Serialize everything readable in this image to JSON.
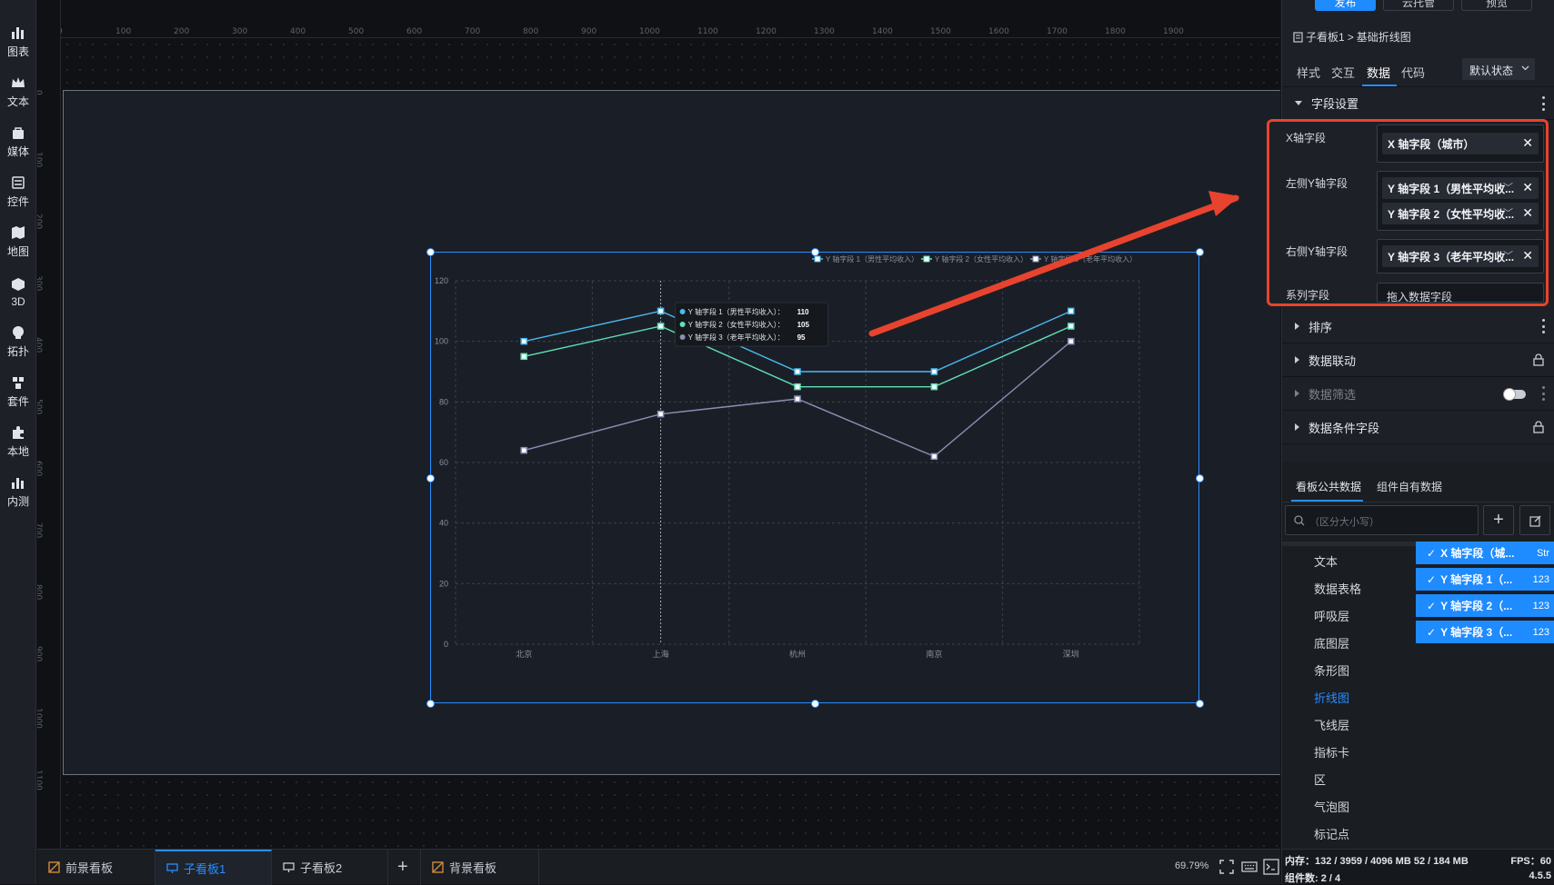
{
  "left_toolbar": [
    {
      "label": "图表",
      "icon": "bar-chart-icon"
    },
    {
      "label": "文本",
      "icon": "crown-icon"
    },
    {
      "label": "媒体",
      "icon": "media-bag-icon"
    },
    {
      "label": "控件",
      "icon": "widget-icon"
    },
    {
      "label": "地图",
      "icon": "map-icon"
    },
    {
      "label": "3D",
      "icon": "cube-icon"
    },
    {
      "label": "拓扑",
      "icon": "topology-icon"
    },
    {
      "label": "套件",
      "icon": "kit-icon"
    },
    {
      "label": "本地",
      "icon": "puzzle-icon"
    },
    {
      "label": "内测",
      "icon": "beta-chart-icon"
    }
  ],
  "ruler": {
    "top_ticks": [
      "0",
      "100",
      "200",
      "300",
      "400",
      "500",
      "600",
      "700",
      "800",
      "900",
      "1000",
      "1100",
      "1200",
      "1300",
      "1400",
      "1500",
      "1600",
      "1700",
      "1800",
      "1900"
    ],
    "left_ticks": [
      "0",
      "100",
      "200",
      "300",
      "400",
      "500",
      "600",
      "700",
      "800",
      "900",
      "1000",
      "1100"
    ]
  },
  "header_buttons": {
    "publish": "发布",
    "cloud": "云托管",
    "preview": "预览"
  },
  "breadcrumb": {
    "parent": "子看板1",
    "sep": ">",
    "current": "基础折线图"
  },
  "panel_tabs": {
    "style": "样式",
    "interaction": "交互",
    "data": "数据",
    "code": "代码",
    "state": "默认状态"
  },
  "field_settings": {
    "title": "字段设置",
    "x_label": "X轴字段",
    "x_value": "X 轴字段（城市）",
    "left_y_label": "左侧Y轴字段",
    "left_y_values": [
      "Y 轴字段 1（男性平均收...",
      "Y 轴字段 2（女性平均收..."
    ],
    "right_y_label": "右侧Y轴字段",
    "right_y_value": "Y 轴字段 3（老年平均收...",
    "series_label": "系列字段",
    "series_placeholder": "拖入数据字段"
  },
  "sections": [
    "排序",
    "数据联动",
    "数据筛选",
    "数据条件字段"
  ],
  "data_tabs": {
    "public": "看板公共数据",
    "own": "组件自有数据"
  },
  "search": {
    "placeholder": "（区分大小写）"
  },
  "dataset_list": [
    "文本",
    "数据表格",
    "呼吸层",
    "底图层",
    "条形图",
    "折线图",
    "飞线层",
    "指标卡",
    "区",
    "气泡图",
    "标记点"
  ],
  "selected_fields": [
    {
      "label": "X 轴字段（城...",
      "type": "Str"
    },
    {
      "label": "Y 轴字段 1（...",
      "type": "123"
    },
    {
      "label": "Y 轴字段 2（...",
      "type": "123"
    },
    {
      "label": "Y 轴字段 3（...",
      "type": "123"
    }
  ],
  "bottom_tabs": [
    {
      "label": "前景看板",
      "icon": "foreground-board-icon"
    },
    {
      "label": "子看板1",
      "icon": "monitor-icon"
    },
    {
      "label": "子看板2",
      "icon": "monitor-icon"
    },
    {
      "label": "+",
      "icon": "add-icon"
    },
    {
      "label": "背景看板",
      "icon": "background-board-icon"
    }
  ],
  "zoom": "69.79%",
  "status": {
    "memory": "内存：132 / 3959 / 4096 MB  52 / 184 MB",
    "fps": "FPS：60",
    "components": "组件数: 2 / 4",
    "version": "4.5.5"
  },
  "chart_data": {
    "type": "line",
    "categories": [
      "北京",
      "上海",
      "杭州",
      "南京",
      "深圳"
    ],
    "ylim": [
      0,
      120
    ],
    "yticks": [
      "0",
      "20",
      "40",
      "60",
      "80",
      "100",
      "120"
    ],
    "series": [
      {
        "name": "Y 轴字段 1（男性平均收入）",
        "values": [
          100,
          110,
          90,
          90,
          110
        ],
        "color": "#4cb8f0"
      },
      {
        "name": "Y 轴字段 2（女性平均收入）",
        "values": [
          95,
          105,
          85,
          85,
          105
        ],
        "color": "#5fe0b4"
      },
      {
        "name": "Y 轴字段 3（老年平均收入）",
        "values": [
          64,
          76,
          81,
          62,
          100
        ],
        "color": "#8a8fb5"
      }
    ],
    "tooltip": {
      "rows": [
        {
          "label": "Y 轴字段 1（男性平均收入）：",
          "value": "110"
        },
        {
          "label": "Y 轴字段 2（女性平均收入）：",
          "value": "105"
        },
        {
          "label": "Y 轴字段 3（老年平均收入）：",
          "value": "95"
        }
      ]
    }
  }
}
